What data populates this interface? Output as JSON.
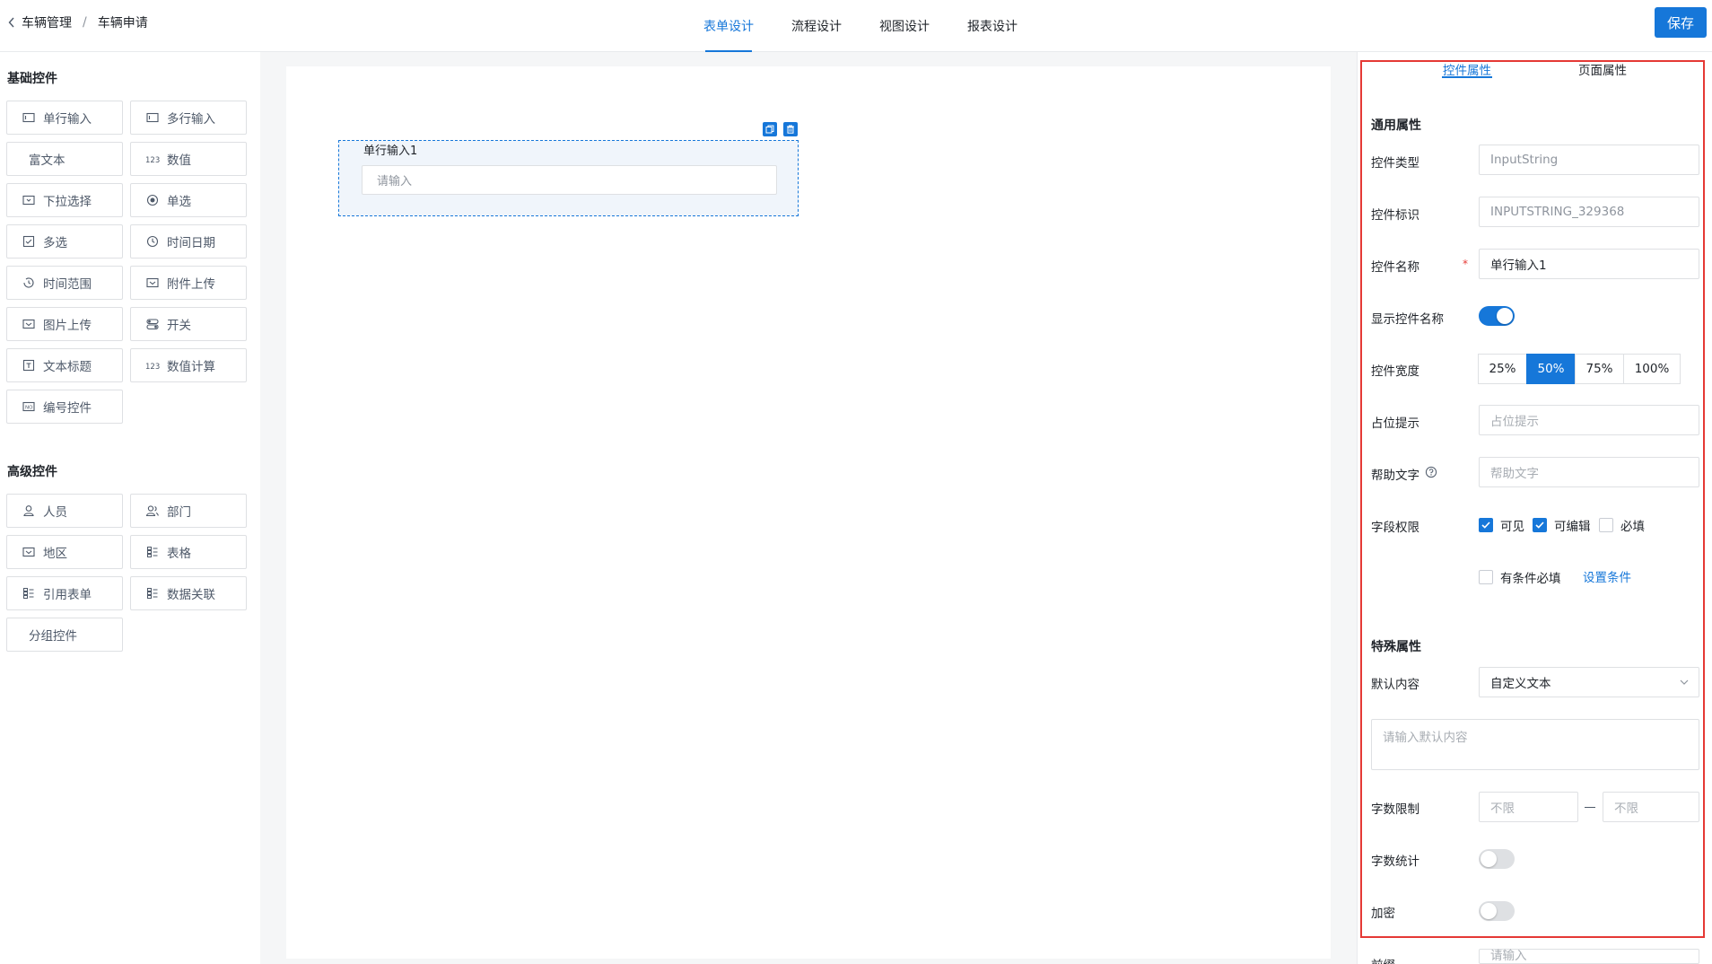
{
  "header": {
    "breadcrumb": [
      "车辆管理",
      "车辆申请"
    ],
    "breadcrumb_sep": "/",
    "tabs": [
      "表单设计",
      "流程设计",
      "视图设计",
      "报表设计"
    ],
    "active_tab": 0,
    "save_label": "保存"
  },
  "palette": {
    "basic_title": "基础控件",
    "basic_items": [
      {
        "label": "单行输入",
        "icon": "input-icon"
      },
      {
        "label": "多行输入",
        "icon": "textarea-icon"
      },
      {
        "label": "富文本",
        "icon": ""
      },
      {
        "label": "数值",
        "icon": "number-icon"
      },
      {
        "label": "下拉选择",
        "icon": "dropdown-icon"
      },
      {
        "label": "单选",
        "icon": "radio-icon"
      },
      {
        "label": "多选",
        "icon": "checkbox-icon"
      },
      {
        "label": "时间日期",
        "icon": "clock-icon"
      },
      {
        "label": "时间范围",
        "icon": "time-range-icon"
      },
      {
        "label": "附件上传",
        "icon": "attachment-icon"
      },
      {
        "label": "图片上传",
        "icon": "image-icon"
      },
      {
        "label": "开关",
        "icon": "switch-icon"
      },
      {
        "label": "文本标题",
        "icon": "title-icon"
      },
      {
        "label": "数值计算",
        "icon": "number-icon"
      },
      {
        "label": "编号控件",
        "icon": "serial-icon"
      }
    ],
    "advanced_title": "高级控件",
    "advanced_items": [
      {
        "label": "人员",
        "icon": "user-icon"
      },
      {
        "label": "部门",
        "icon": "group-icon"
      },
      {
        "label": "地区",
        "icon": "region-icon"
      },
      {
        "label": "表格",
        "icon": "table-icon"
      },
      {
        "label": "引用表单",
        "icon": "table-icon"
      },
      {
        "label": "数据关联",
        "icon": "table-icon"
      },
      {
        "label": "分组控件",
        "icon": ""
      }
    ]
  },
  "canvas": {
    "field_label": "单行输入1",
    "field_placeholder": "请输入"
  },
  "panel": {
    "tabs": [
      "控件属性",
      "页面属性"
    ],
    "common_title": "通用属性",
    "type_label": "控件类型",
    "type_value": "InputString",
    "id_label": "控件标识",
    "id_value": "INPUTSTRING_329368",
    "name_label": "控件名称",
    "name_required": "*",
    "name_value": "单行输入1",
    "show_name_label": "显示控件名称",
    "show_name_on": true,
    "width_label": "控件宽度",
    "width_options": [
      "25%",
      "50%",
      "75%",
      "100%"
    ],
    "width_selected": "50%",
    "placeholder_label": "占位提示",
    "placeholder_ph": "占位提示",
    "help_label": "帮助文字",
    "help_ph": "帮助文字",
    "perm_label": "字段权限",
    "perm_visible": "可见",
    "perm_editable": "可编辑",
    "perm_required": "必填",
    "cond_required": "有条件必填",
    "set_condition": "设置条件",
    "special_title": "特殊属性",
    "default_label": "默认内容",
    "default_value": "自定义文本",
    "default_textarea_ph": "请输入默认内容",
    "limit_label": "字数限制",
    "limit_min_ph": "不限",
    "limit_max_ph": "不限",
    "count_label": "字数统计",
    "encrypt_label": "加密",
    "prefix_label": "前缀",
    "prefix_ph": "请输入"
  }
}
